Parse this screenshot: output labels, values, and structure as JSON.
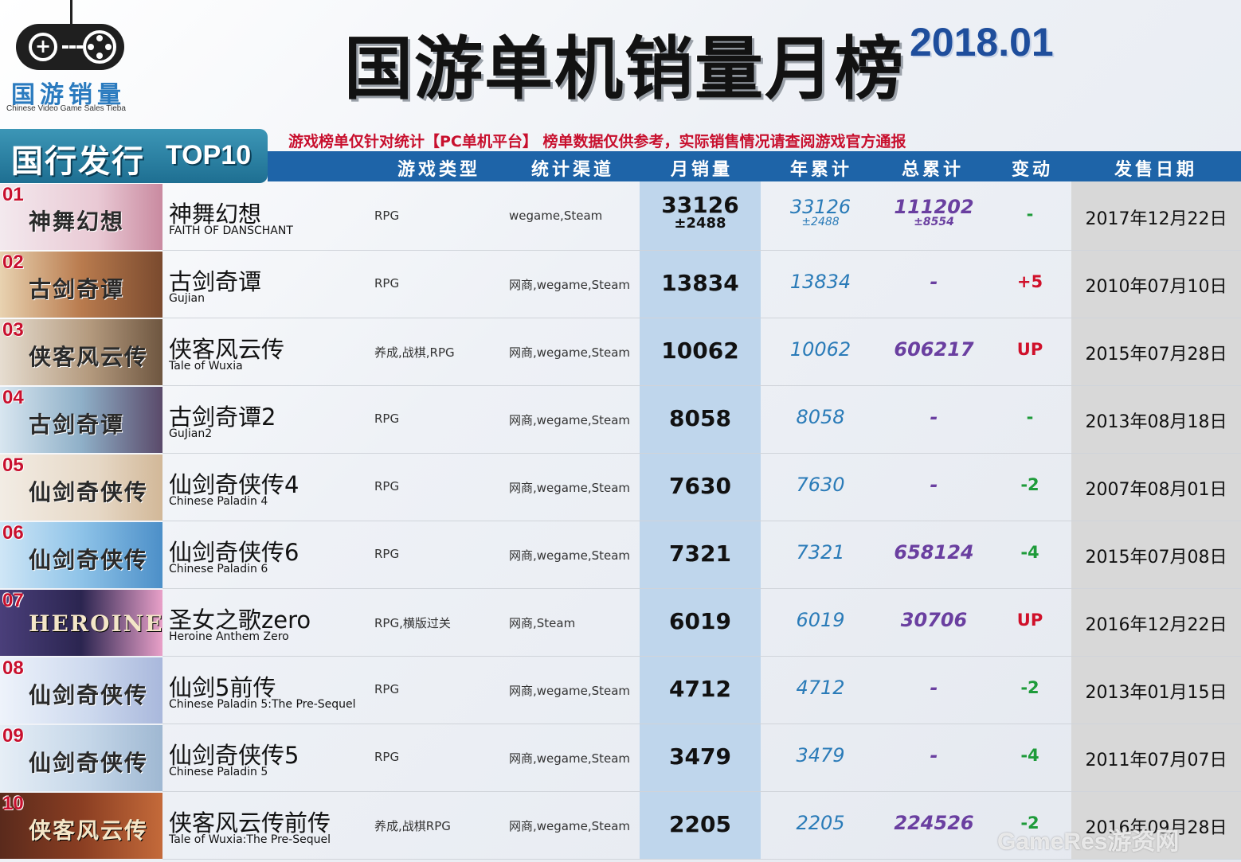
{
  "logo": {
    "cn": "国游销量",
    "en": "Chinese Video Game Sales Tieba"
  },
  "title": "国游单机销量月榜",
  "period": "2018.01",
  "badge": {
    "cn": "国行发行",
    "en": "TOP10"
  },
  "notice": "游戏榜单仅针对统计【PC单机平台】 榜单数据仅供参考，实际销售情况请查阅游戏官方通报",
  "headers": {
    "genre": "游戏类型",
    "channel": "统计渠道",
    "month": "月销量",
    "year": "年累计",
    "total": "总累计",
    "change": "变动",
    "date": "发售日期"
  },
  "colors": {
    "up": "#d0102a",
    "down": "#1e9b3a",
    "neutral": "#1e9b3a"
  },
  "rows": [
    {
      "rank": "01",
      "thumb": "神舞幻想",
      "name_cn": "神舞幻想",
      "name_en": "FAITH OF DANSCHANT",
      "genre": "RPG",
      "channel": "wegame,Steam",
      "month": "33126",
      "month_pm": "±2488",
      "year": "33126",
      "year_pm": "±2488",
      "total": "111202",
      "total_pm": "±8554",
      "change": "-",
      "change_type": "neutral",
      "date": "2017年12月22日"
    },
    {
      "rank": "02",
      "thumb": "古剑奇谭",
      "name_cn": "古剑奇谭",
      "name_en": "Gujian",
      "genre": "RPG",
      "channel": "网商,wegame,Steam",
      "month": "13834",
      "year": "13834",
      "total": "-",
      "change": "+5",
      "change_type": "up",
      "date": "2010年07月10日"
    },
    {
      "rank": "03",
      "thumb": "侠客风云传",
      "name_cn": "侠客风云传",
      "name_en": "Tale of Wuxia",
      "genre": "养成,战棋,RPG",
      "channel": "网商,wegame,Steam",
      "month": "10062",
      "year": "10062",
      "total": "606217",
      "change": "UP",
      "change_type": "up",
      "date": "2015年07月28日"
    },
    {
      "rank": "04",
      "thumb": "古剑奇谭",
      "name_cn": "古剑奇谭2",
      "name_en": "GuJian2",
      "genre": "RPG",
      "channel": "网商,wegame,Steam",
      "month": "8058",
      "year": "8058",
      "total": "-",
      "change": "-",
      "change_type": "neutral",
      "date": "2013年08月18日"
    },
    {
      "rank": "05",
      "thumb": "仙剑奇侠传",
      "name_cn": "仙剑奇侠传4",
      "name_en": "Chinese Paladin 4",
      "genre": "RPG",
      "channel": "网商,wegame,Steam",
      "month": "7630",
      "year": "7630",
      "total": "-",
      "change": "-2",
      "change_type": "down",
      "date": "2007年08月01日"
    },
    {
      "rank": "06",
      "thumb": "仙剑奇侠传",
      "name_cn": "仙剑奇侠传6",
      "name_en": "Chinese Paladin 6",
      "genre": "RPG",
      "channel": "网商,wegame,Steam",
      "month": "7321",
      "year": "7321",
      "total": "658124",
      "change": "-4",
      "change_type": "down",
      "date": "2015年07月08日"
    },
    {
      "rank": "07",
      "thumb": "HEROINE ANTHEM",
      "name_cn": "圣女之歌zero",
      "name_en": "Heroine Anthem Zero",
      "genre": "RPG,横版过关",
      "channel": "网商,Steam",
      "month": "6019",
      "year": "6019",
      "total": "30706",
      "change": "UP",
      "change_type": "up",
      "date": "2016年12月22日"
    },
    {
      "rank": "08",
      "thumb": "仙剑奇侠传",
      "name_cn": "仙剑5前传",
      "name_en": "Chinese Paladin 5:The Pre-Sequel",
      "genre": "RPG",
      "channel": "网商,wegame,Steam",
      "month": "4712",
      "year": "4712",
      "total": "-",
      "change": "-2",
      "change_type": "down",
      "date": "2013年01月15日"
    },
    {
      "rank": "09",
      "thumb": "仙剑奇侠传",
      "name_cn": "仙剑奇侠传5",
      "name_en": "Chinese Paladin 5",
      "genre": "RPG",
      "channel": "网商,wegame,Steam",
      "month": "3479",
      "year": "3479",
      "total": "-",
      "change": "-4",
      "change_type": "down",
      "date": "2011年07月07日"
    },
    {
      "rank": "10",
      "thumb": "侠客风云传",
      "name_cn": "侠客风云传前传",
      "name_en": "Tale of Wuxia:The Pre-Sequel",
      "genre": "养成,战棋RPG",
      "channel": "网商,wegame,Steam",
      "month": "2205",
      "year": "2205",
      "total": "224526",
      "change": "-2",
      "change_type": "down",
      "date": "2016年09月28日"
    }
  ],
  "watermark": "GameRes游资网"
}
